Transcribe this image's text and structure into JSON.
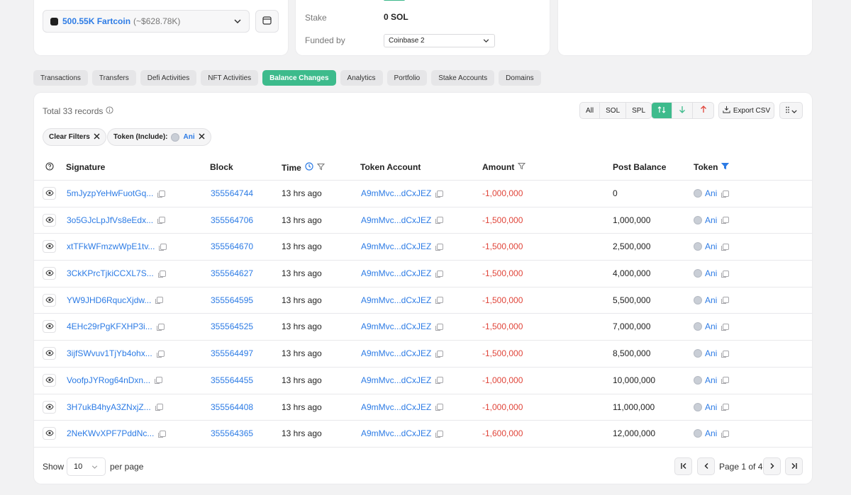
{
  "wallet": {
    "amount": "500.55K Fartcoin",
    "usd": "(~$628.78K)"
  },
  "stake": {
    "label": "Stake",
    "value": "0 SOL"
  },
  "funded": {
    "label": "Funded by",
    "value": "Coinbase 2"
  },
  "tabs": [
    "Transactions",
    "Transfers",
    "Defi Activities",
    "NFT Activities",
    "Balance Changes",
    "Analytics",
    "Portfolio",
    "Stake Accounts",
    "Domains"
  ],
  "active_tab": "Balance Changes",
  "toolbar": {
    "total": "Total 33 records",
    "filter_all": "All",
    "filter_sol": "SOL",
    "filter_spl": "SPL",
    "export": "Export CSV"
  },
  "filters": {
    "clear": "Clear Filters",
    "token_label": "Token (Include):",
    "token_value": "Ani"
  },
  "columns": {
    "signature": "Signature",
    "block": "Block",
    "time": "Time",
    "token_account": "Token Account",
    "amount": "Amount",
    "post_balance": "Post Balance",
    "token": "Token"
  },
  "rows": [
    {
      "signature": "5mJyzpYeHwFuotGq...",
      "block": "355564744",
      "time": "13 hrs ago",
      "account": "A9mMvc...dCxJEZ",
      "amount": "-1,000,000",
      "post_balance": "0",
      "token": "Ani"
    },
    {
      "signature": "3o5GJcLpJfVs8eEdx...",
      "block": "355564706",
      "time": "13 hrs ago",
      "account": "A9mMvc...dCxJEZ",
      "amount": "-1,500,000",
      "post_balance": "1,000,000",
      "token": "Ani"
    },
    {
      "signature": "xtTFkWFmzwWpE1tv...",
      "block": "355564670",
      "time": "13 hrs ago",
      "account": "A9mMvc...dCxJEZ",
      "amount": "-1,500,000",
      "post_balance": "2,500,000",
      "token": "Ani"
    },
    {
      "signature": "3CkKPrcTjkiCCXL7S...",
      "block": "355564627",
      "time": "13 hrs ago",
      "account": "A9mMvc...dCxJEZ",
      "amount": "-1,500,000",
      "post_balance": "4,000,000",
      "token": "Ani"
    },
    {
      "signature": "YW9JHD6RqucXjdw...",
      "block": "355564595",
      "time": "13 hrs ago",
      "account": "A9mMvc...dCxJEZ",
      "amount": "-1,500,000",
      "post_balance": "5,500,000",
      "token": "Ani"
    },
    {
      "signature": "4EHc29rPgKFXHP3i...",
      "block": "355564525",
      "time": "13 hrs ago",
      "account": "A9mMvc...dCxJEZ",
      "amount": "-1,500,000",
      "post_balance": "7,000,000",
      "token": "Ani"
    },
    {
      "signature": "3ijfSWvuv1TjYb4ohx...",
      "block": "355564497",
      "time": "13 hrs ago",
      "account": "A9mMvc...dCxJEZ",
      "amount": "-1,500,000",
      "post_balance": "8,500,000",
      "token": "Ani"
    },
    {
      "signature": "VoofpJYRog64nDxn...",
      "block": "355564455",
      "time": "13 hrs ago",
      "account": "A9mMvc...dCxJEZ",
      "amount": "-1,000,000",
      "post_balance": "10,000,000",
      "token": "Ani"
    },
    {
      "signature": "3H7ukB4hyA3ZNxjZ...",
      "block": "355564408",
      "time": "13 hrs ago",
      "account": "A9mMvc...dCxJEZ",
      "amount": "-1,000,000",
      "post_balance": "11,000,000",
      "token": "Ani"
    },
    {
      "signature": "2NeKWvXPF7PddNc...",
      "block": "355564365",
      "time": "13 hrs ago",
      "account": "A9mMvc...dCxJEZ",
      "amount": "-1,600,000",
      "post_balance": "12,000,000",
      "token": "Ani"
    }
  ],
  "pagination": {
    "show": "Show",
    "per_page_value": "10",
    "per_page": "per page",
    "page_text": "Page 1 of 4"
  },
  "colors": {
    "accent": "#3dbb8c",
    "link": "#2c7be5",
    "negative": "#e0453a"
  }
}
